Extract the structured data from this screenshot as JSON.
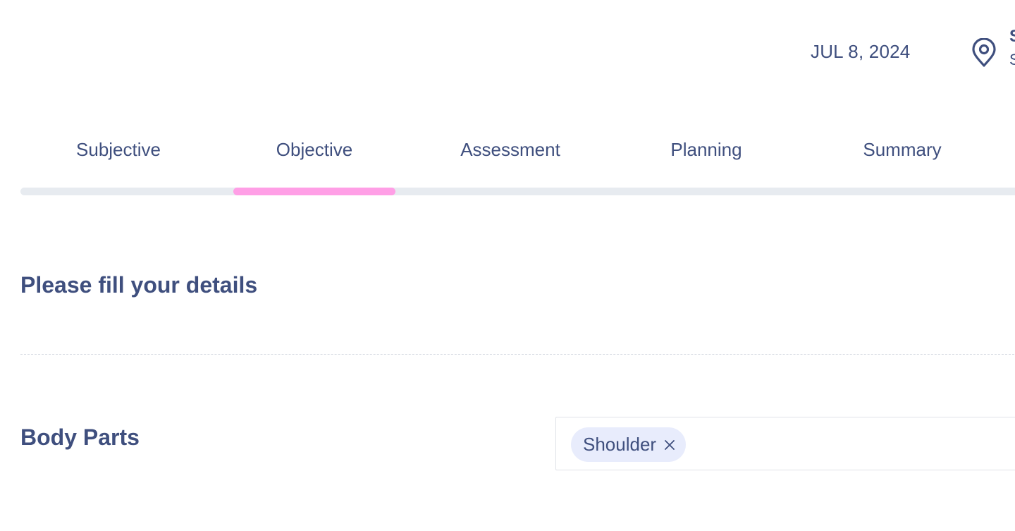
{
  "header": {
    "date": "JUL 8, 2024",
    "location": {
      "icon": "map-pin-icon",
      "name": "S",
      "sub": "S"
    }
  },
  "tabs": [
    {
      "label": "Subjective"
    },
    {
      "label": "Objective",
      "active": true
    },
    {
      "label": "Assessment"
    },
    {
      "label": "Planning"
    },
    {
      "label": "Summary"
    }
  ],
  "progress": {
    "active_step": 2,
    "total_steps": 5
  },
  "form": {
    "section_title": "Please fill your details",
    "body_parts": {
      "label": "Body Parts",
      "selected": [
        {
          "label": "Shoulder",
          "remove_icon": "close-icon"
        }
      ]
    }
  },
  "colors": {
    "text": "#3f4f7e",
    "progress_track": "#e7ebf0",
    "progress_active": "#ff9fe6",
    "chip_bg": "#e8ecfc"
  }
}
